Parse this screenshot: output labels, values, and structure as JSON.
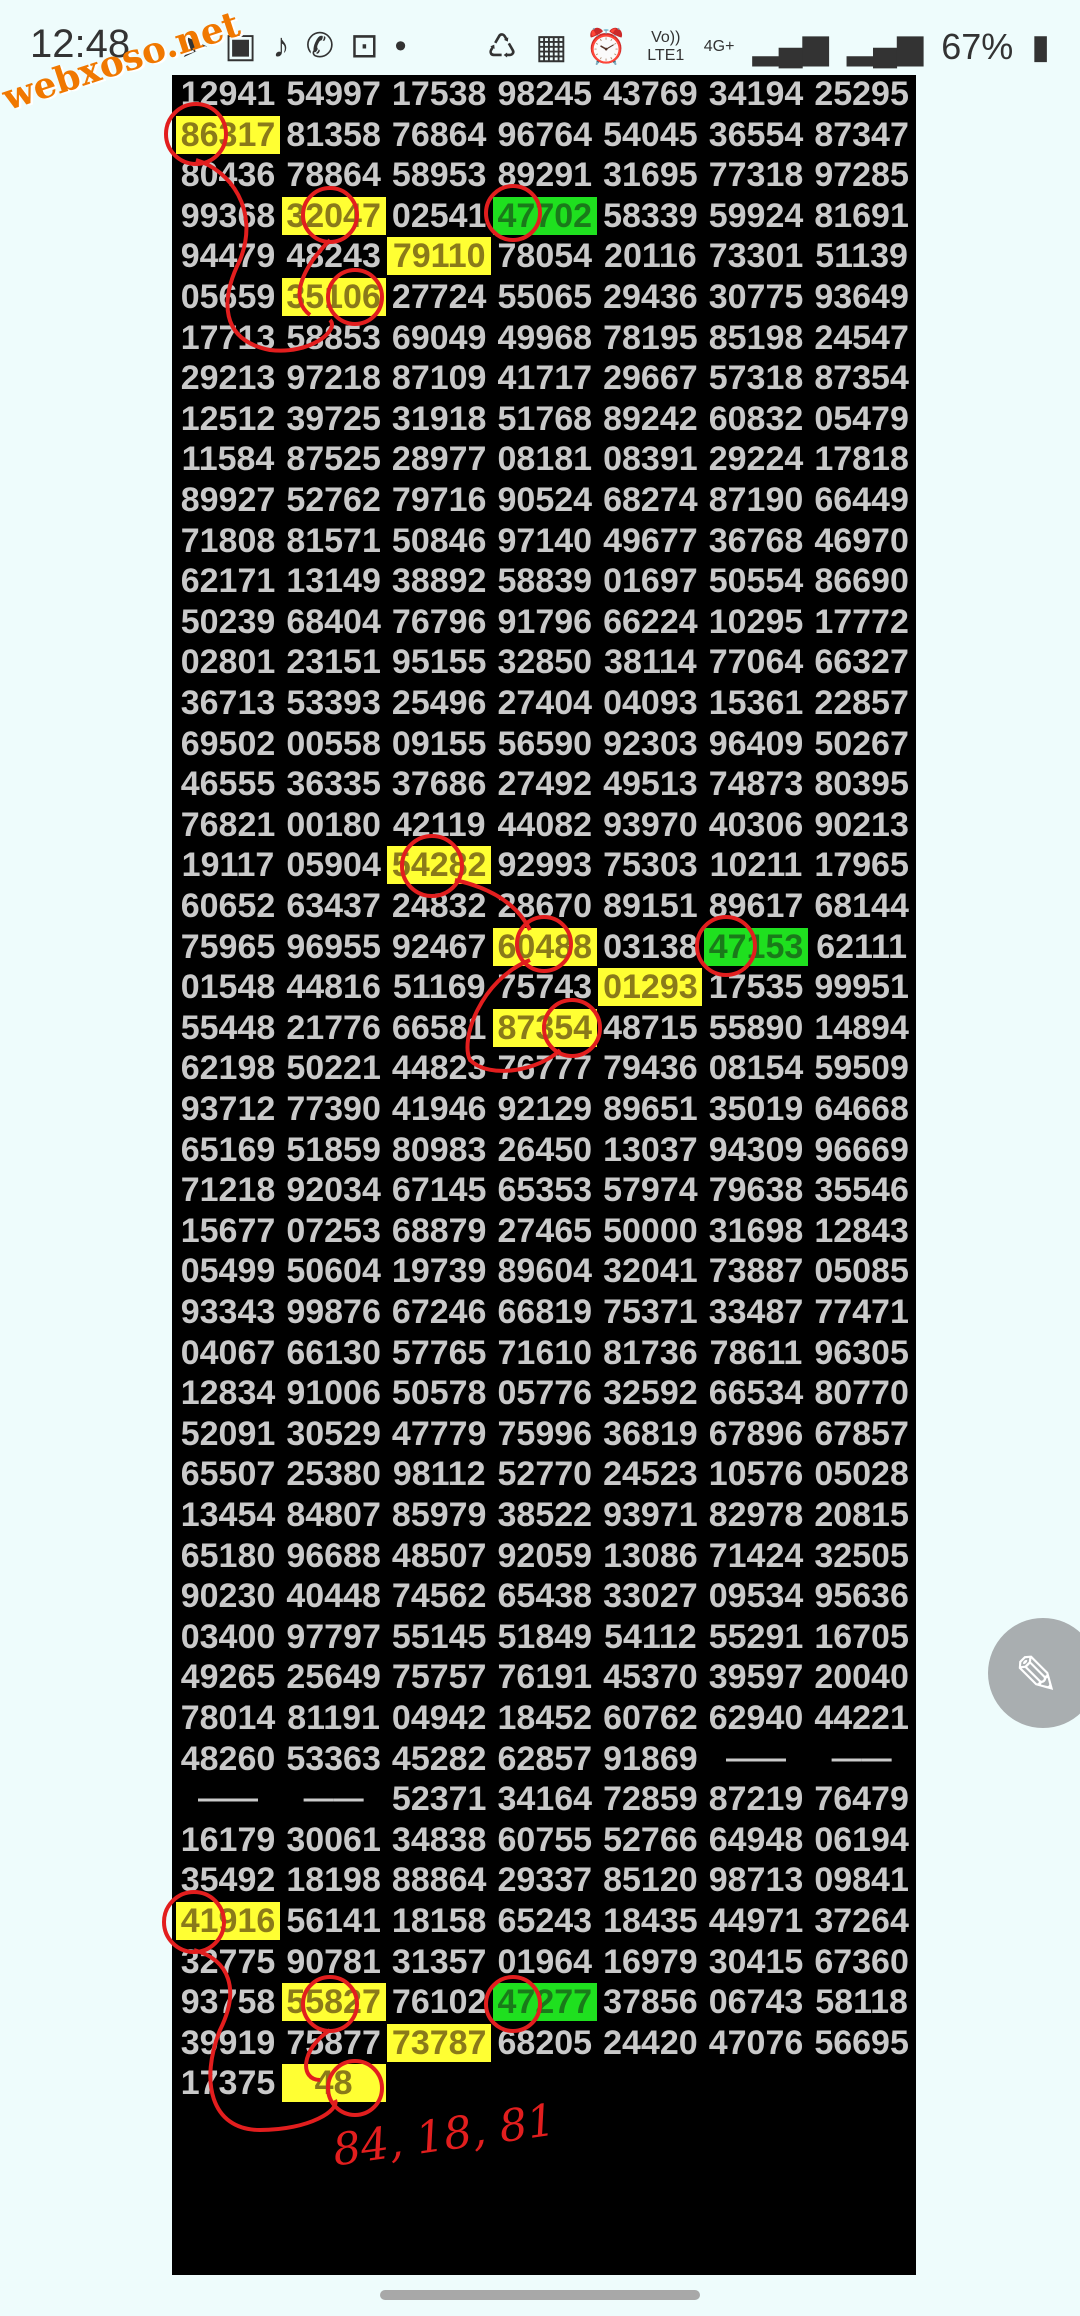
{
  "status_bar": {
    "time": "12:48",
    "left_icons": [
      "location-icon",
      "inbox-icon",
      "bell-icon",
      "phone-icon",
      "shopping-bag-icon",
      "dot-icon"
    ],
    "volte_label": "Vo)) LTE1",
    "network_label": "4G+",
    "battery_percent": "67%"
  },
  "watermark": "webxoso.net",
  "table": {
    "rows": [
      [
        "12941",
        "54997",
        "17538",
        "98245",
        "43769",
        "34194",
        "25295"
      ],
      [
        "86317",
        "81358",
        "76864",
        "96764",
        "54045",
        "36554",
        "87347"
      ],
      [
        "80436",
        "78864",
        "58953",
        "89291",
        "31695",
        "77318",
        "97285"
      ],
      [
        "99368",
        "32047",
        "02541",
        "47702",
        "58339",
        "59924",
        "81691"
      ],
      [
        "94479",
        "48243",
        "79110",
        "78054",
        "20116",
        "73301",
        "51139"
      ],
      [
        "05659",
        "35106",
        "27724",
        "55065",
        "29436",
        "30775",
        "93649"
      ],
      [
        "17713",
        "58853",
        "69049",
        "49968",
        "78195",
        "85198",
        "24547"
      ],
      [
        "29213",
        "97218",
        "87109",
        "41717",
        "29667",
        "57318",
        "87354"
      ],
      [
        "12512",
        "39725",
        "31918",
        "51768",
        "89242",
        "60832",
        "05479"
      ],
      [
        "11584",
        "87525",
        "28977",
        "08181",
        "08391",
        "29224",
        "17818"
      ],
      [
        "89927",
        "52762",
        "79716",
        "90524",
        "68274",
        "87190",
        "66449"
      ],
      [
        "71808",
        "81571",
        "50846",
        "97140",
        "49677",
        "36768",
        "46970"
      ],
      [
        "62171",
        "13149",
        "38892",
        "58839",
        "01697",
        "50554",
        "86690"
      ],
      [
        "50239",
        "68404",
        "76796",
        "91796",
        "66224",
        "10295",
        "17772"
      ],
      [
        "02801",
        "23151",
        "95155",
        "32850",
        "38114",
        "77064",
        "66327"
      ],
      [
        "36713",
        "53393",
        "25496",
        "27404",
        "04093",
        "15361",
        "22857"
      ],
      [
        "69502",
        "00558",
        "09155",
        "56590",
        "92303",
        "96409",
        "50267"
      ],
      [
        "46555",
        "36335",
        "37686",
        "27492",
        "49513",
        "74873",
        "80395"
      ],
      [
        "76821",
        "00180",
        "42119",
        "44082",
        "93970",
        "40306",
        "90213"
      ],
      [
        "19117",
        "05904",
        "54282",
        "92993",
        "75303",
        "10211",
        "17965"
      ],
      [
        "60652",
        "63437",
        "24832",
        "28670",
        "89151",
        "89617",
        "68144"
      ],
      [
        "75965",
        "96955",
        "92467",
        "60488",
        "03138",
        "47153",
        "62111"
      ],
      [
        "01548",
        "44816",
        "51169",
        "75743",
        "01293",
        "17535",
        "99951"
      ],
      [
        "55448",
        "21776",
        "66581",
        "87354",
        "48715",
        "55890",
        "14894"
      ],
      [
        "62198",
        "50221",
        "44823",
        "76777",
        "79436",
        "08154",
        "59509"
      ],
      [
        "93712",
        "77390",
        "41946",
        "92129",
        "89651",
        "35019",
        "64668"
      ],
      [
        "65169",
        "51859",
        "80983",
        "26450",
        "13037",
        "94309",
        "96669"
      ],
      [
        "71218",
        "92034",
        "67145",
        "65353",
        "57974",
        "79638",
        "35546"
      ],
      [
        "15677",
        "07253",
        "68879",
        "27465",
        "50000",
        "31698",
        "12843"
      ],
      [
        "05499",
        "50604",
        "19739",
        "89604",
        "32041",
        "73887",
        "05085"
      ],
      [
        "93343",
        "99876",
        "67246",
        "66819",
        "75371",
        "33487",
        "77471"
      ],
      [
        "04067",
        "66130",
        "57765",
        "71610",
        "81736",
        "78611",
        "96305"
      ],
      [
        "12834",
        "91006",
        "50578",
        "05776",
        "32592",
        "66534",
        "80770"
      ],
      [
        "52091",
        "30529",
        "47779",
        "75996",
        "36819",
        "67896",
        "67857"
      ],
      [
        "65507",
        "25380",
        "98112",
        "52770",
        "24523",
        "10576",
        "05028"
      ],
      [
        "13454",
        "84807",
        "85979",
        "38522",
        "93971",
        "82978",
        "20815"
      ],
      [
        "65180",
        "96688",
        "48507",
        "92059",
        "13086",
        "71424",
        "32505"
      ],
      [
        "90230",
        "40448",
        "74562",
        "65438",
        "33027",
        "09534",
        "95636"
      ],
      [
        "03400",
        "97797",
        "55145",
        "51849",
        "54112",
        "55291",
        "16705"
      ],
      [
        "49265",
        "25649",
        "75757",
        "76191",
        "45370",
        "39597",
        "20040"
      ],
      [
        "78014",
        "81191",
        "04942",
        "18452",
        "60762",
        "62940",
        "44221"
      ],
      [
        "48260",
        "53363",
        "45282",
        "62857",
        "91869",
        "——",
        "——"
      ],
      [
        "——",
        "——",
        "52371",
        "34164",
        "72859",
        "87219",
        "76479"
      ],
      [
        "16179",
        "30061",
        "34838",
        "60755",
        "52766",
        "64948",
        "06194"
      ],
      [
        "35492",
        "18198",
        "88864",
        "29337",
        "85120",
        "98713",
        "09841"
      ],
      [
        "41916",
        "56141",
        "18158",
        "65243",
        "18435",
        "44971",
        "37264"
      ],
      [
        "32775",
        "90781",
        "31357",
        "01964",
        "16979",
        "30415",
        "67360"
      ],
      [
        "93758",
        "55827",
        "76102",
        "47277",
        "37856",
        "06743",
        "58118"
      ],
      [
        "39919",
        "75877",
        "73787",
        "68205",
        "24420",
        "47076",
        "56695"
      ],
      [
        "17375",
        "48",
        "",
        "",
        "",
        "",
        ""
      ]
    ],
    "yellow_cells": [
      [
        1,
        0
      ],
      [
        3,
        1
      ],
      [
        4,
        2
      ],
      [
        5,
        1
      ],
      [
        19,
        2
      ],
      [
        21,
        3
      ],
      [
        22,
        4
      ],
      [
        23,
        3
      ],
      [
        45,
        0
      ],
      [
        47,
        1
      ],
      [
        48,
        2
      ],
      [
        49,
        1
      ]
    ],
    "green_cells": [
      [
        3,
        3
      ],
      [
        21,
        5
      ],
      [
        47,
        3
      ]
    ]
  },
  "annotation": {
    "handwritten_text": "84, 18, 81",
    "color": "#e21e1e"
  },
  "fab": {
    "icon": "pencil-icon"
  }
}
